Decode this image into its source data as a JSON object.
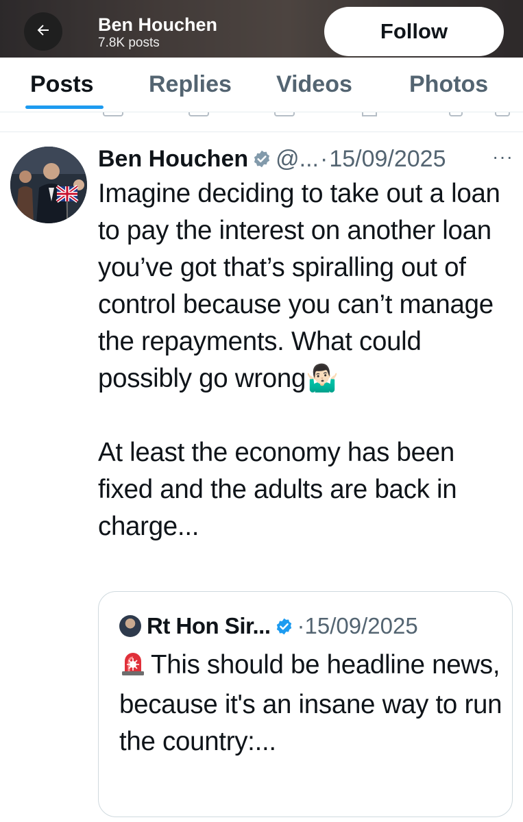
{
  "header": {
    "name": "Ben Houchen",
    "post_count": "7.8K posts",
    "follow_label": "Follow"
  },
  "tabs": [
    {
      "label": "Posts",
      "active": true
    },
    {
      "label": "Replies",
      "active": false
    },
    {
      "label": "Videos",
      "active": false
    },
    {
      "label": "Photos",
      "active": false
    }
  ],
  "tweet": {
    "author": "Ben Houchen",
    "handle": "@...",
    "separator": "·",
    "date": "15/09/2025",
    "more": "···",
    "text": "Imagine deciding to take out a loan to pay the interest on another loan you’ve got that’s spiralling out of control because you can’t manage the repayments. What could possibly go wrong🤷🏻‍♂️\n\nAt least the economy has been fixed and the adults are back in charge..."
  },
  "quote": {
    "author": "Rt Hon Sir...",
    "separator": "·",
    "date": "15/09/2025",
    "text": "This should be headline news, because it's an insane way to run the country:..."
  },
  "colors": {
    "accent": "#1d9bf0",
    "text_primary": "#0f1419",
    "text_secondary": "#536471",
    "border": "#cfd9de"
  },
  "icons": {
    "back": "arrow-left-icon",
    "verified": "verified-badge-icon",
    "more": "more-dots-icon",
    "siren": "siren-icon"
  }
}
